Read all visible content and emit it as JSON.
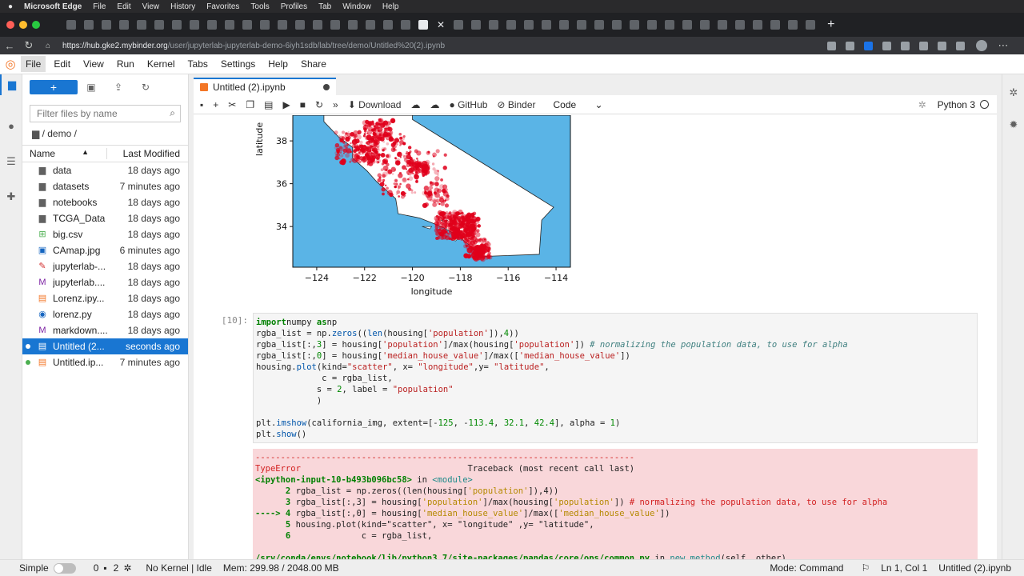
{
  "mac_menu": [
    "Microsoft Edge",
    "File",
    "Edit",
    "View",
    "History",
    "Favorites",
    "Tools",
    "Profiles",
    "Tab",
    "Window",
    "Help"
  ],
  "browser": {
    "url_host": "https://hub.gke2.mybinder.org",
    "url_path": "/user/jupyterlab-jupyterlab-demo-6iyh1sdb/lab/tree/demo/Untitled%20(2).ipynb"
  },
  "jupyter_menu": [
    "File",
    "Edit",
    "View",
    "Run",
    "Kernel",
    "Tabs",
    "Settings",
    "Help",
    "Share"
  ],
  "filebrowser": {
    "filter_placeholder": "Filter files by name",
    "breadcrumb": "/ demo /",
    "col_name": "Name",
    "col_modified": "Last Modified",
    "files": [
      {
        "name": "data",
        "modified": "18 days ago",
        "icon": "folder-icon",
        "color": "#616161"
      },
      {
        "name": "datasets",
        "modified": "7 minutes ago",
        "icon": "folder-icon",
        "color": "#616161"
      },
      {
        "name": "notebooks",
        "modified": "18 days ago",
        "icon": "folder-icon",
        "color": "#616161"
      },
      {
        "name": "TCGA_Data",
        "modified": "18 days ago",
        "icon": "folder-icon",
        "color": "#616161"
      },
      {
        "name": "big.csv",
        "modified": "18 days ago",
        "icon": "spreadsheet-icon",
        "color": "#4caf50"
      },
      {
        "name": "CAmap.jpg",
        "modified": "6 minutes ago",
        "icon": "image-icon",
        "color": "#1565c0"
      },
      {
        "name": "jupyterlab-...",
        "modified": "18 days ago",
        "icon": "pdf-icon",
        "color": "#d32f2f"
      },
      {
        "name": "jupyterlab....",
        "modified": "18 days ago",
        "icon": "markdown-icon",
        "color": "#7b1fa2"
      },
      {
        "name": "Lorenz.ipy...",
        "modified": "18 days ago",
        "icon": "notebook-icon",
        "color": "#f37626"
      },
      {
        "name": "lorenz.py",
        "modified": "18 days ago",
        "icon": "python-icon",
        "color": "#1565c0"
      },
      {
        "name": "markdown....",
        "modified": "18 days ago",
        "icon": "markdown-icon",
        "color": "#7b1fa2"
      },
      {
        "name": "Untitled (2...",
        "modified": "seconds ago",
        "icon": "notebook-icon",
        "color": "#f37626",
        "running": true,
        "selected": true
      },
      {
        "name": "Untitled.ip...",
        "modified": "7 minutes ago",
        "icon": "notebook-icon",
        "color": "#f37626",
        "running": true
      }
    ]
  },
  "notebook": {
    "tab_title": "Untitled (2).ipynb",
    "toolbar": {
      "download": "Download",
      "github": "GitHub",
      "binder": "Binder",
      "cell_type": "Code",
      "kernel": "Python 3"
    },
    "cell_prompt": "[10]:"
  },
  "chart_data": {
    "type": "scatter",
    "xlabel": "longitude",
    "ylabel": "latitude",
    "x_ticks": [
      "−124",
      "−122",
      "−120",
      "−118",
      "−116",
      "−114"
    ],
    "y_ticks": [
      "38",
      "36",
      "34"
    ],
    "xlim": [
      -125,
      -113.4
    ],
    "ylim": [
      32.1,
      39.2
    ],
    "point_color": "#e0001b",
    "background_color": "#5ab4e6",
    "land_color": "#ffffff"
  },
  "code_lines": [
    [
      [
        "kw",
        "import"
      ],
      [
        "",
        "numpy "
      ],
      [
        "kw",
        "as"
      ],
      [
        "",
        "np"
      ]
    ],
    [
      [
        "",
        "rgba_list = np."
      ],
      [
        "fn",
        "zeros"
      ],
      [
        "",
        "(("
      ],
      [
        "fn",
        "len"
      ],
      [
        "",
        "(housing["
      ],
      [
        "str",
        "'population'"
      ],
      [
        "",
        "]),"
      ],
      [
        "num",
        "4"
      ],
      [
        "",
        "))"
      ]
    ],
    [
      [
        "",
        "rgba_list[:,"
      ],
      [
        "num",
        "3"
      ],
      [
        "",
        "] = housing["
      ],
      [
        "str",
        "'population'"
      ],
      [
        "",
        "]/max(housing["
      ],
      [
        "str",
        "'population'"
      ],
      [
        "",
        "]) "
      ],
      [
        "cm",
        "# normalizing the population data, to use for alpha"
      ]
    ],
    [
      [
        "",
        "rgba_list[:,"
      ],
      [
        "num",
        "0"
      ],
      [
        "",
        "] = housing["
      ],
      [
        "str",
        "'median_house_value'"
      ],
      [
        "",
        "]/max(["
      ],
      [
        "str",
        "'median_house_value'"
      ],
      [
        "",
        "])"
      ]
    ],
    [
      [
        "",
        "housing."
      ],
      [
        "fn",
        "plot"
      ],
      [
        "",
        "(kind="
      ],
      [
        "str",
        "\"scatter\""
      ],
      [
        "",
        ", x= "
      ],
      [
        "str",
        "\"longitude\""
      ],
      [
        "",
        ",y= "
      ],
      [
        "str",
        "\"latitude\""
      ],
      [
        "",
        ","
      ]
    ],
    [
      [
        "",
        "             c = rgba_list,"
      ]
    ],
    [
      [
        "",
        "            s = "
      ],
      [
        "num",
        "2"
      ],
      [
        "",
        ", label = "
      ],
      [
        "str",
        "\"population\""
      ]
    ],
    [
      [
        "",
        "            )"
      ]
    ],
    [
      [
        "",
        ""
      ]
    ],
    [
      [
        "",
        "plt."
      ],
      [
        "fn",
        "imshow"
      ],
      [
        "",
        "(california_img, extent=[-"
      ],
      [
        "num",
        "125"
      ],
      [
        "",
        ", -"
      ],
      [
        "num",
        "113.4"
      ],
      [
        "",
        ", "
      ],
      [
        "num",
        "32.1"
      ],
      [
        "",
        ", "
      ],
      [
        "num",
        "42.4"
      ],
      [
        "",
        "], alpha = "
      ],
      [
        "num",
        "1"
      ],
      [
        "",
        ")"
      ]
    ],
    [
      [
        "",
        "plt."
      ],
      [
        "fn",
        "show"
      ],
      [
        "",
        "()"
      ]
    ]
  ],
  "error_lines": [
    [
      [
        "red",
        "---------------------------------------------------------------------------"
      ]
    ],
    [
      [
        "red",
        "TypeError"
      ],
      [
        "",
        "                                 Traceback (most recent call last)"
      ]
    ],
    [
      [
        "grn",
        "<ipython-input-10-b493b096bc58>"
      ],
      [
        "",
        " in "
      ],
      [
        "cyn",
        "<module>"
      ]
    ],
    [
      [
        "grn",
        "      2"
      ],
      [
        "",
        " rgba_list = np.zeros((len(housing["
      ],
      [
        "ynm",
        "'population'"
      ],
      [
        "",
        "]),4))"
      ]
    ],
    [
      [
        "grn",
        "      3"
      ],
      [
        "",
        " rgba_list[:,3] = housing["
      ],
      [
        "ynm",
        "'population'"
      ],
      [
        "",
        "]/max(housing["
      ],
      [
        "ynm",
        "'population'"
      ],
      [
        "",
        "]) "
      ],
      [
        "red",
        "# normalizing the population data, to use for alpha"
      ]
    ],
    [
      [
        "grn",
        "----> 4"
      ],
      [
        "",
        " rgba_list[:,0] = housing["
      ],
      [
        "ynm",
        "'median_house_value'"
      ],
      [
        "",
        "]/max(["
      ],
      [
        "ynm",
        "'median_house_value'"
      ],
      [
        "",
        "])"
      ]
    ],
    [
      [
        "grn",
        "      5"
      ],
      [
        "",
        " housing.plot(kind=\"scatter\", x= \"longitude\" ,y= \"latitude\","
      ]
    ],
    [
      [
        "grn",
        "      6"
      ],
      [
        "",
        "              c = rgba_list,"
      ]
    ],
    [
      [
        "",
        ""
      ]
    ],
    [
      [
        "grn",
        "/srv/conda/envs/notebook/lib/python3.7/site-packages/pandas/core/ops/common.py"
      ],
      [
        "",
        " in "
      ],
      [
        "cyn",
        "new_method"
      ],
      [
        "",
        "(self, other)"
      ]
    ]
  ],
  "status": {
    "mode_label": "Simple",
    "terminals": "0",
    "kernels": "2",
    "kernel_status": "No Kernel | Idle",
    "memory": "Mem: 299.98 / 2048.00 MB",
    "mode": "Mode: Command",
    "cursor": "Ln 1, Col 1",
    "filename": "Untitled (2).ipynb"
  }
}
